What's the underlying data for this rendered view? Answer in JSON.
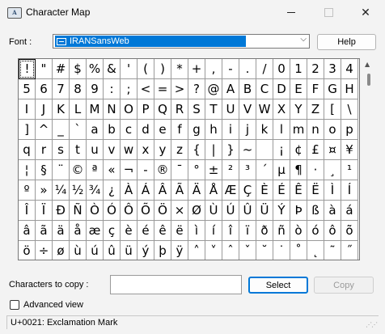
{
  "window": {
    "title": "Character Map",
    "app_icon_glyph": "A",
    "controls": {
      "minimize_icon": "minimize-icon",
      "maximize_icon": "maximize-icon",
      "close_glyph": "✕"
    }
  },
  "font": {
    "label": "Font :",
    "selected": "IRANSansWeb",
    "selected_bg": "#0078d7",
    "dropdown_glyph": "⌵"
  },
  "help_button": {
    "label": "Help"
  },
  "grid": {
    "columns": 20,
    "selected_index": 0,
    "characters": [
      "!",
      "\"",
      "#",
      "$",
      "%",
      "&",
      "'",
      "(",
      ")",
      "*",
      "+",
      ",",
      "-",
      ".",
      "/",
      "0",
      "1",
      "2",
      "3",
      "4",
      "5",
      "6",
      "7",
      "8",
      "9",
      ":",
      ";",
      "<",
      "=",
      ">",
      "?",
      "@",
      "A",
      "B",
      "C",
      "D",
      "E",
      "F",
      "G",
      "H",
      "I",
      "J",
      "K",
      "L",
      "M",
      "N",
      "O",
      "P",
      "Q",
      "R",
      "S",
      "T",
      "U",
      "V",
      "W",
      "X",
      "Y",
      "Z",
      "[",
      "\\",
      "]",
      "^",
      "_",
      "`",
      "a",
      "b",
      "c",
      "d",
      "e",
      "f",
      "g",
      "h",
      "i",
      "j",
      "k",
      "l",
      "m",
      "n",
      "o",
      "p",
      "q",
      "r",
      "s",
      "t",
      "u",
      "v",
      "w",
      "x",
      "y",
      "z",
      "{",
      "|",
      "}",
      "~",
      " ",
      "¡",
      "¢",
      "£",
      "¤",
      "¥",
      "¦",
      "§",
      "¨",
      "©",
      "ª",
      "«",
      "¬",
      "-",
      "®",
      "¯",
      "°",
      "±",
      "²",
      "³",
      "´",
      "µ",
      "¶",
      "·",
      "¸",
      "¹",
      "º",
      "»",
      "¼",
      "½",
      "¾",
      "¿",
      "À",
      "Á",
      "Â",
      "Ã",
      "Ä",
      "Å",
      "Æ",
      "Ç",
      "È",
      "É",
      "Ê",
      "Ë",
      "Ì",
      "Í",
      "Î",
      "Ï",
      "Ð",
      "Ñ",
      "Ò",
      "Ó",
      "Ô",
      "Õ",
      "Ö",
      "×",
      "Ø",
      "Ù",
      "Ú",
      "Û",
      "Ü",
      "Ý",
      "Þ",
      "ß",
      "à",
      "á",
      "â",
      "ã",
      "ä",
      "å",
      "æ",
      "ç",
      "è",
      "é",
      "ê",
      "ë",
      "ì",
      "í",
      "î",
      "ï",
      "ð",
      "ñ",
      "ò",
      "ó",
      "ô",
      "õ",
      "ö",
      "÷",
      "ø",
      "ù",
      "ú",
      "û",
      "ü",
      "ý",
      "þ",
      "ÿ",
      "˄",
      "˅",
      "ˆ",
      "ˇ",
      "˘",
      "˙",
      "˚",
      "˛",
      "˜",
      "˝"
    ]
  },
  "copy": {
    "label": "Characters to copy :",
    "value": "",
    "select_label": "Select",
    "copy_label": "Copy"
  },
  "advanced": {
    "label": "Advanced view",
    "checked": false
  },
  "status": {
    "text": "U+0021: Exclamation Mark"
  }
}
